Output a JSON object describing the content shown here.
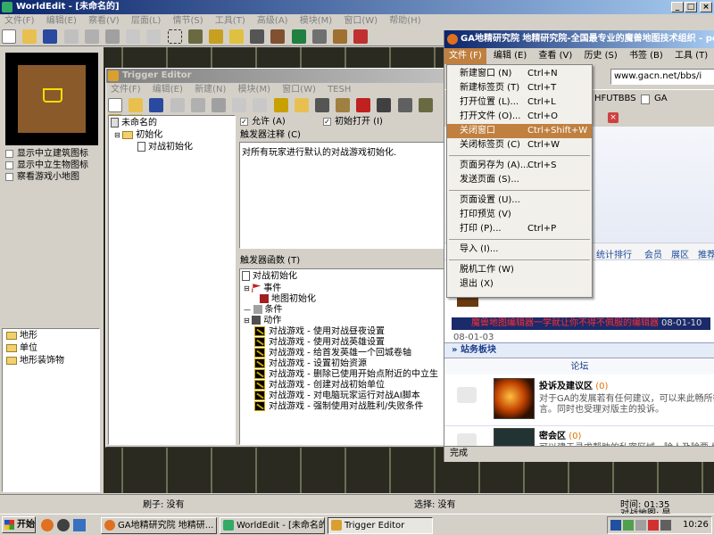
{
  "worldedit": {
    "title": "WorldEdit - [未命名的]",
    "menu": [
      "文件(F)",
      "编辑(E)",
      "察看(V)",
      "层面(L)",
      "情节(S)",
      "工具(T)",
      "高级(A)",
      "模块(M)",
      "窗口(W)",
      "帮助(H)"
    ],
    "minimap_options": [
      "显示中立建筑图标",
      "显示中立生物图标",
      "察看游戏小地图"
    ],
    "palette_items": [
      "地形",
      "单位",
      "地形装饰物"
    ],
    "status": {
      "brush_label": "刷子: 没有",
      "select_label": "选择: 没有",
      "time_label": "时间: 01:35",
      "battle_map_label": "对战地图: 是"
    }
  },
  "trigger_editor": {
    "title": "Trigger Editor",
    "menu": [
      "文件(F)",
      "编辑(E)",
      "新建(N)",
      "模块(M)",
      "窗口(W)",
      "TESH"
    ],
    "tree": {
      "root": "未命名的",
      "category": "初始化",
      "trigger": "对战初始化"
    },
    "enabled_label": "允许 (A)",
    "initially_on_label": "初始打开 (I)",
    "comment_label": "触发器注释 (C)",
    "comment_text": "对所有玩家进行默认的对战游戏初始化.",
    "functions_label": "触发器函数 (T)",
    "functions": {
      "trigger_name": "对战初始化",
      "events_label": "事件",
      "event_item": "地图初始化",
      "conditions_label": "条件",
      "actions_label": "动作",
      "actions": [
        "对战游戏 - 使用对战昼夜设置",
        "对战游戏 - 使用对战英雄设置",
        "对战游戏 - 给首发英雄一个回城卷轴",
        "对战游戏 - 设置初始资源",
        "对战游戏 - 删除已使用开始点附近的中立生",
        "对战游戏 - 创建对战初始单位",
        "对战游戏 - 对电脑玩家运行对战AI脚本",
        "对战游戏 - 强制使用对战胜利/失败条件"
      ]
    }
  },
  "browser": {
    "title": "GA地精研究院 地精研究院-全国最专业的魔兽地图技术组织 - pow",
    "menu": [
      "文件 (F)",
      "编辑 (E)",
      "查看 (V)",
      "历史 (S)",
      "书签 (B)",
      "工具 (T)",
      "帮"
    ],
    "url_partial": "www.gacn.net/bbs/i",
    "bookmark_tabs": [
      "HFUTBBS",
      "GA"
    ],
    "nav_links": [
      "统计排行",
      "会员",
      "展区",
      "推荐"
    ],
    "marquee_text": "魔兽地图编辑器一学就让你不得不佩服的编辑器",
    "marquee_date": "08-01-10",
    "date_small": "08-01-03",
    "section_title": "站务板块",
    "forum_header": "论坛",
    "forums": [
      {
        "name": "投诉及建议区",
        "count": "(0)",
        "desc1": "对于GA的发展若有任何建议，可以来此畅所欲",
        "desc2": "言。同时也受理对版主的投诉。"
      },
      {
        "name": "密会区",
        "count": "(0)",
        "desc1": "可以建于寻求帮助的私密区域，除人及除要人物"
      }
    ],
    "status_text": "完成",
    "file_menu": [
      {
        "label": "新建窗口 (N)",
        "shortcut": "Ctrl+N"
      },
      {
        "label": "新建标签页 (T)",
        "shortcut": "Ctrl+T"
      },
      {
        "label": "打开位置 (L)...",
        "shortcut": "Ctrl+L"
      },
      {
        "label": "打开文件 (O)...",
        "shortcut": "Ctrl+O"
      },
      {
        "label": "关闭窗口",
        "shortcut": "Ctrl+Shift+W"
      },
      {
        "label": "关闭标签页 (C)",
        "shortcut": "Ctrl+W"
      },
      {
        "label": "页面另存为 (A)...",
        "shortcut": "Ctrl+S"
      },
      {
        "label": "发送页面 (S)...",
        "shortcut": ""
      },
      {
        "label": "页面设置 (U)...",
        "shortcut": ""
      },
      {
        "label": "打印预览 (V)",
        "shortcut": ""
      },
      {
        "label": "打印 (P)...",
        "shortcut": "Ctrl+P"
      },
      {
        "label": "导入 (I)...",
        "shortcut": ""
      },
      {
        "label": "脱机工作 (W)",
        "shortcut": ""
      },
      {
        "label": "退出 (X)",
        "shortcut": ""
      }
    ]
  },
  "taskbar": {
    "start_label": "开始",
    "tasks": [
      "GA地精研究院 地精研...",
      "WorldEdit - [未命名的]",
      "Trigger Editor"
    ],
    "clock": "10:26"
  }
}
